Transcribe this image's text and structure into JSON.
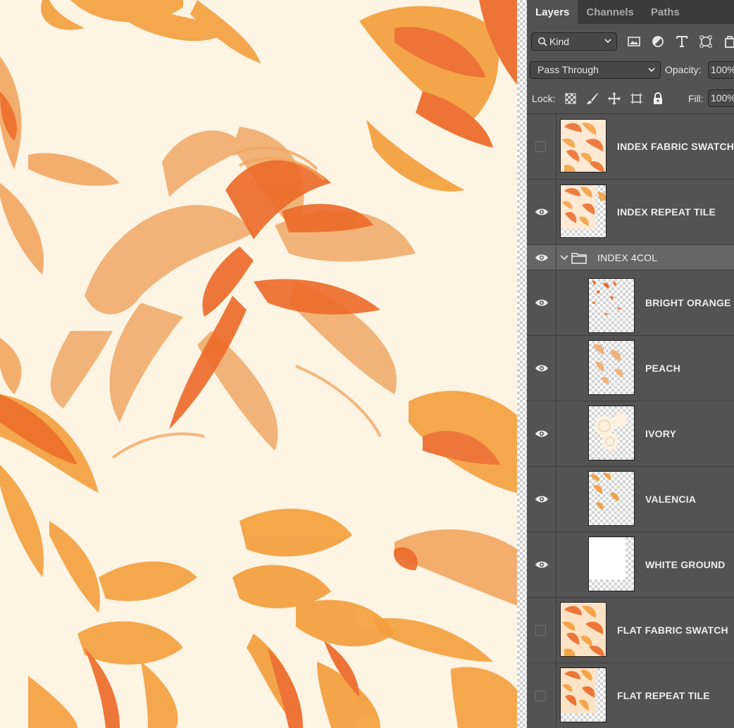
{
  "app": "Adobe Photoshop",
  "panel": {
    "tabs": [
      {
        "label": "Layers",
        "active": true
      },
      {
        "label": "Channels",
        "active": false
      },
      {
        "label": "Paths",
        "active": false
      }
    ],
    "filter": {
      "kind_label": "Kind"
    },
    "blend_mode": "Pass Through",
    "opacity_label": "Opacity:",
    "opacity_value": "100%",
    "lock_label": "Lock:",
    "fill_label": "Fill:",
    "fill_value": "100%"
  },
  "layers": [
    {
      "name": "INDEX FABRIC SWATCH",
      "visible": false,
      "type": "layer",
      "thumb": "pattern"
    },
    {
      "name": "INDEX REPEAT TILE",
      "visible": true,
      "type": "layer",
      "thumb": "pattern-partial"
    },
    {
      "name": "INDEX 4COL",
      "visible": true,
      "type": "group",
      "expanded": true
    },
    {
      "name": "BRIGHT ORANGE",
      "visible": true,
      "type": "layer",
      "indent": true,
      "thumb": "sparse-red"
    },
    {
      "name": "PEACH",
      "visible": true,
      "type": "layer",
      "indent": true,
      "thumb": "sparse-peach"
    },
    {
      "name": "IVORY",
      "visible": true,
      "type": "layer",
      "indent": true,
      "thumb": "sparse-ivory"
    },
    {
      "name": "VALENCIA",
      "visible": true,
      "type": "layer",
      "indent": true,
      "thumb": "sparse-orange"
    },
    {
      "name": "WHITE GROUND",
      "visible": true,
      "type": "layer",
      "indent": true,
      "thumb": "white"
    },
    {
      "name": "FLAT FABRIC SWATCH",
      "visible": false,
      "type": "layer",
      "thumb": "pattern"
    },
    {
      "name": "FLAT REPEAT TILE",
      "visible": false,
      "type": "layer",
      "thumb": "pattern-partial"
    }
  ],
  "colors": {
    "background_ivory": "#fdf4e4",
    "peach": "#f2a661",
    "light_peach": "#f0ae6f",
    "bright_orange": "#ec6a28",
    "valencia": "#f49f3c",
    "panel_bg": "#535353",
    "tab_bar": "#3b3b3b"
  }
}
